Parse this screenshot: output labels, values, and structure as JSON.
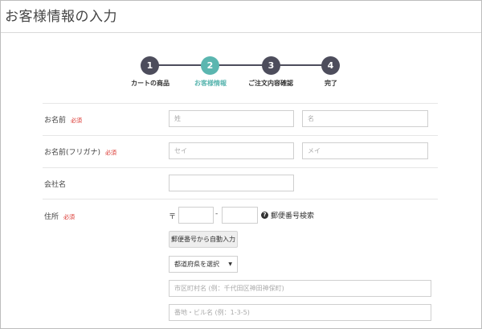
{
  "page": {
    "title": "お客様情報の入力"
  },
  "steps": [
    {
      "number": "1",
      "label": "カートの商品",
      "active": false
    },
    {
      "number": "2",
      "label": "お客様情報",
      "active": true
    },
    {
      "number": "3",
      "label": "ご注文内容確認",
      "active": false
    },
    {
      "number": "4",
      "label": "完了",
      "active": false
    }
  ],
  "form": {
    "required_badge": "必須",
    "name": {
      "label": "お名前",
      "last_placeholder": "姓",
      "first_placeholder": "名"
    },
    "kana": {
      "label": "お名前(フリガナ)",
      "last_placeholder": "セイ",
      "first_placeholder": "メイ"
    },
    "company": {
      "label": "会社名",
      "placeholder": ""
    },
    "address": {
      "label": "住所",
      "postal_mark": "〒",
      "postal_dash": "-",
      "postal_search_label": "郵便番号検索",
      "autofill_button": "郵便番号から自動入力",
      "prefecture_select": "都道府県を選択",
      "city_placeholder": "市区町村名 (例：千代田区神田神保町)",
      "street_placeholder": "番地・ビル名 (例：1-3-5)"
    }
  },
  "colors": {
    "active_step": "#5bb6b0",
    "inactive_step": "#4d4d5c",
    "required": "#d9302a"
  }
}
